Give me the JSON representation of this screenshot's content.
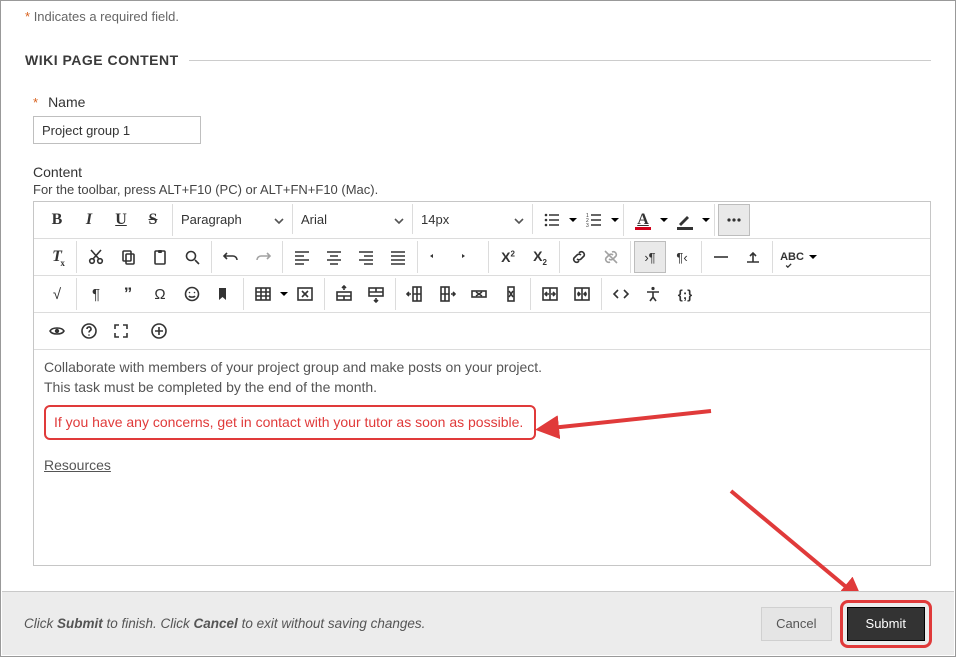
{
  "required_note": "Indicates a required field.",
  "section_title": "WIKI PAGE CONTENT",
  "name": {
    "label": "Name",
    "value": "Project group 1"
  },
  "content_label": "Content",
  "toolbar_hint": "For the toolbar, press ALT+F10 (PC) or ALT+FN+F10 (Mac).",
  "toolbar": {
    "block_format": "Paragraph",
    "font_family": "Arial",
    "font_size": "14px",
    "text_color": "#d0021b",
    "highlight_color": "#333333"
  },
  "editor": {
    "line1": "Collaborate with members of your project group and make posts on your project.",
    "line2": "This task must be completed by the end of the month.",
    "highlight": "If you have any concerns, get in contact with your tutor as soon as possible.",
    "resources": "Resources"
  },
  "footer": {
    "prefix": "Click ",
    "submit_word": "Submit",
    "mid": " to finish. Click ",
    "cancel_word": "Cancel",
    "suffix": " to exit without saving changes.",
    "cancel_btn": "Cancel",
    "submit_btn": "Submit"
  }
}
